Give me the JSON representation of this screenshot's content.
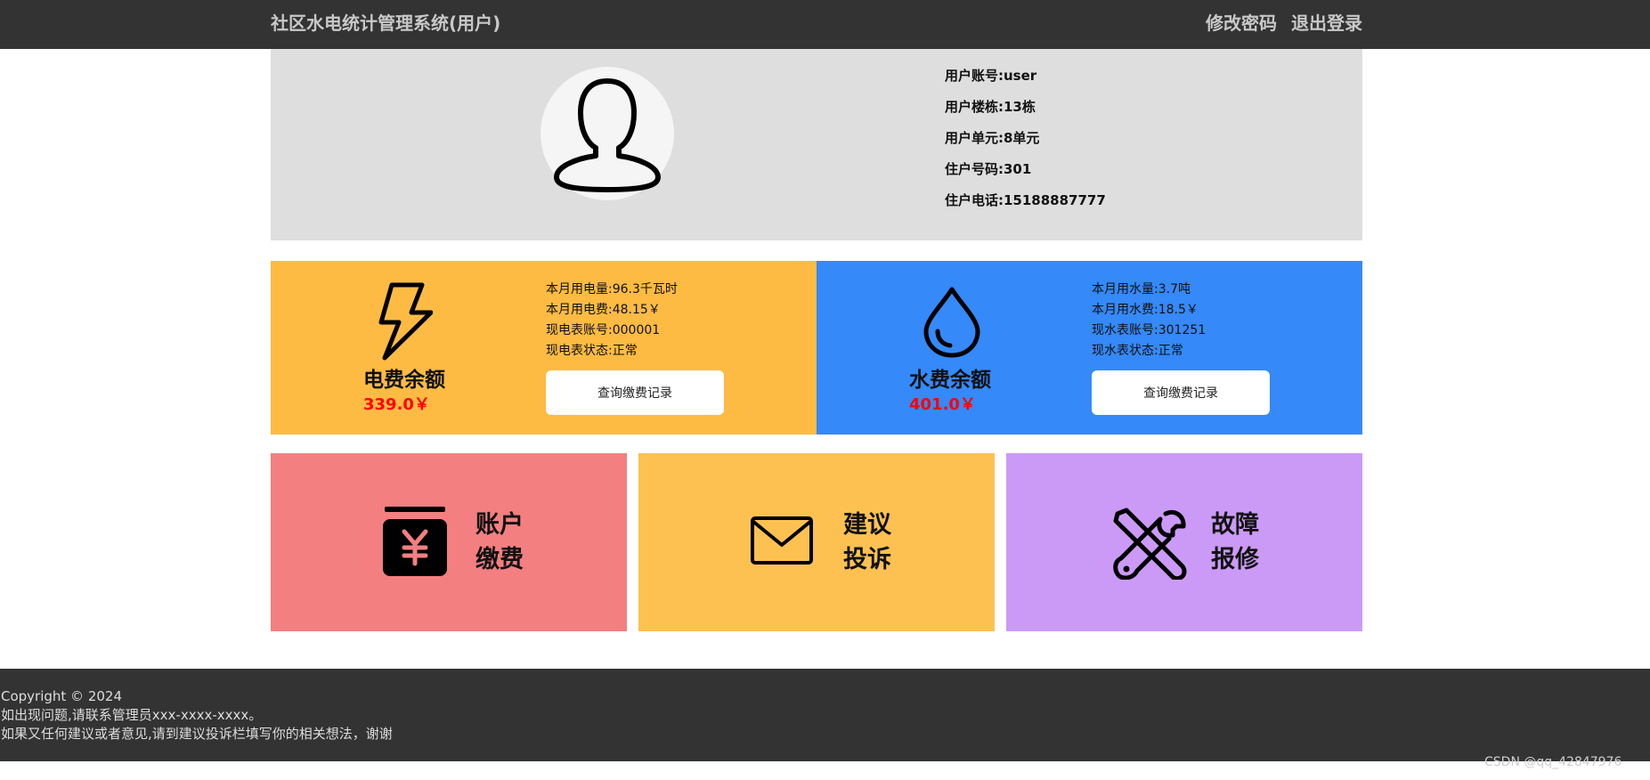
{
  "header": {
    "title": "社区水电统计管理系统(用户)",
    "change_password": "修改密码",
    "logout": "退出登录"
  },
  "profile": {
    "account": "用户账号:user",
    "building": "用户楼栋:13栋",
    "unit": "用户单元:8单元",
    "room": "住户号码:301",
    "phone": "住户电话:15188887777"
  },
  "electric": {
    "title": "电费余额",
    "balance": "339.0￥",
    "usage": "本月用电量:96.3千瓦时",
    "fee": "本月用电费:48.15￥",
    "meter": "现电表账号:000001",
    "status": "现电表状态:正常",
    "query_button": "查询缴费记录",
    "color": "#fdbb43"
  },
  "water": {
    "title": "水费余额",
    "balance": "401.0￥",
    "usage": "本月用水量:3.7吨",
    "fee": "本月用水费:18.5￥",
    "meter": "现水表账号:301251",
    "status": "现水表状态:正常",
    "query_button": "查询缴费记录",
    "color": "#3589f8"
  },
  "tiles": [
    {
      "line1": "账户",
      "line2": "缴费",
      "icon": "wallet-yen-icon",
      "color": "#f47f80"
    },
    {
      "line1": "建议",
      "line2": "投诉",
      "icon": "envelope-icon",
      "color": "#fdc152"
    },
    {
      "line1": "故障",
      "line2": "报修",
      "icon": "wrench-screwdriver-icon",
      "color": "#cb9af6"
    }
  ],
  "footer": {
    "copyright": "Copyright © 2024",
    "contact": "如出现问题,请联系管理员xxx-xxxx-xxxx。",
    "suggestion": "如果又任何建议或者意见,请到建议投诉栏填写你的相关想法，谢谢"
  },
  "watermark": "CSDN @qq_42847976"
}
